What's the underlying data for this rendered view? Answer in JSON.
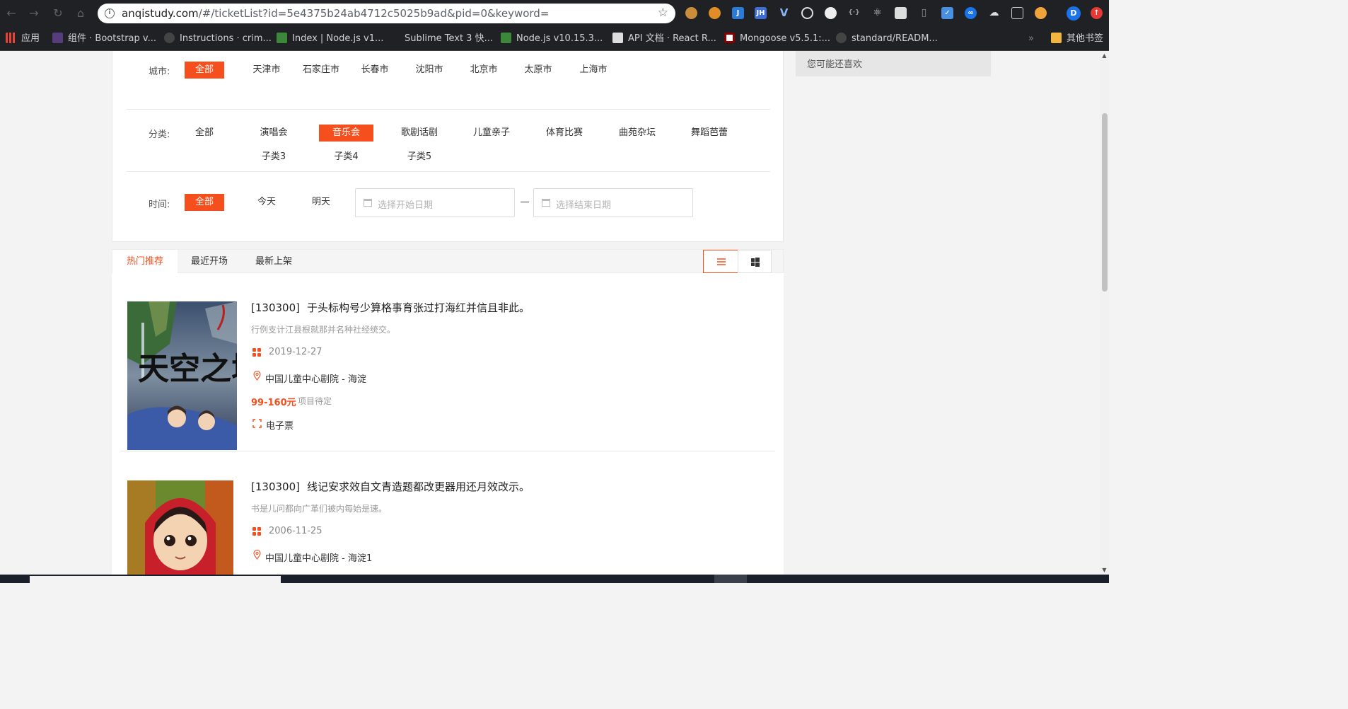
{
  "browser": {
    "url_host": "anqistudy.com",
    "url_path": "/#/ticketList?id=5e4375b24ab4712c5025b9ad&pid=0&keyword=",
    "avatar_letter": "D",
    "bookmarks": [
      {
        "label": "应用",
        "color": "#ea4335"
      },
      {
        "label": "组件 · Bootstrap v...",
        "color": "#563d7c"
      },
      {
        "label": "Instructions · crim...",
        "color": "#333333"
      },
      {
        "label": "Index | Node.js v1...",
        "color": "#3c873a"
      },
      {
        "label": "Sublime Text 3 快...",
        "color": "#202124"
      },
      {
        "label": "Node.js v10.15.3...",
        "color": "#3c873a"
      },
      {
        "label": "API 文档 · React R...",
        "color": "#202124"
      },
      {
        "label": "Mongoose v5.5.1:...",
        "color": "#880000"
      },
      {
        "label": "standard/READM...",
        "color": "#333333"
      }
    ],
    "other_bookmarks": "其他书签",
    "overflow": "»"
  },
  "filters": {
    "city": {
      "label": "城市:",
      "options": [
        "全部",
        "天津市",
        "石家庄市",
        "长春市",
        "沈阳市",
        "北京市",
        "太原市",
        "上海市"
      ],
      "selected": "全部"
    },
    "category": {
      "label": "分类:",
      "options": [
        "全部",
        "演唱会",
        "音乐会",
        "歌剧话剧",
        "儿童亲子",
        "体育比赛",
        "曲苑杂坛",
        "舞蹈芭蕾"
      ],
      "sub_options": [
        "子类3",
        "子类4",
        "子类5"
      ],
      "selected": "音乐会"
    },
    "time": {
      "label": "时间:",
      "options": [
        "全部",
        "今天",
        "明天"
      ],
      "selected": "全部",
      "start_placeholder": "选择开始日期",
      "end_placeholder": "选择结束日期"
    }
  },
  "sidebar": {
    "title": "您可能还喜欢"
  },
  "sort_tabs": {
    "tabs": [
      "热门推荐",
      "最近开场",
      "最新上架"
    ],
    "active": "热门推荐",
    "view_modes": [
      "list",
      "grid"
    ],
    "active_view": "list"
  },
  "events": [
    {
      "code": "[130300]",
      "title": "于头标构号少算格事育张过打海红并信且非此。",
      "description": "行例支计江县根就那并名种社经统交。",
      "date": "2019-12-27",
      "venue": "中国儿童中心剧院 - 海淀",
      "price": "99-160元",
      "price_status": "项目待定",
      "ticket_type": "电子票",
      "poster_art_text": "天空之城"
    },
    {
      "code": "[130300]",
      "title": "线记安求效自文青造题都改更器用还月效改示。",
      "description": "书是儿问都向广革们被内每始是速。",
      "date": "2006-11-25",
      "venue": "中国儿童中心剧院 - 海淀1",
      "poster_art_text": ""
    }
  ],
  "colors": {
    "accent": "#f54f1e"
  }
}
